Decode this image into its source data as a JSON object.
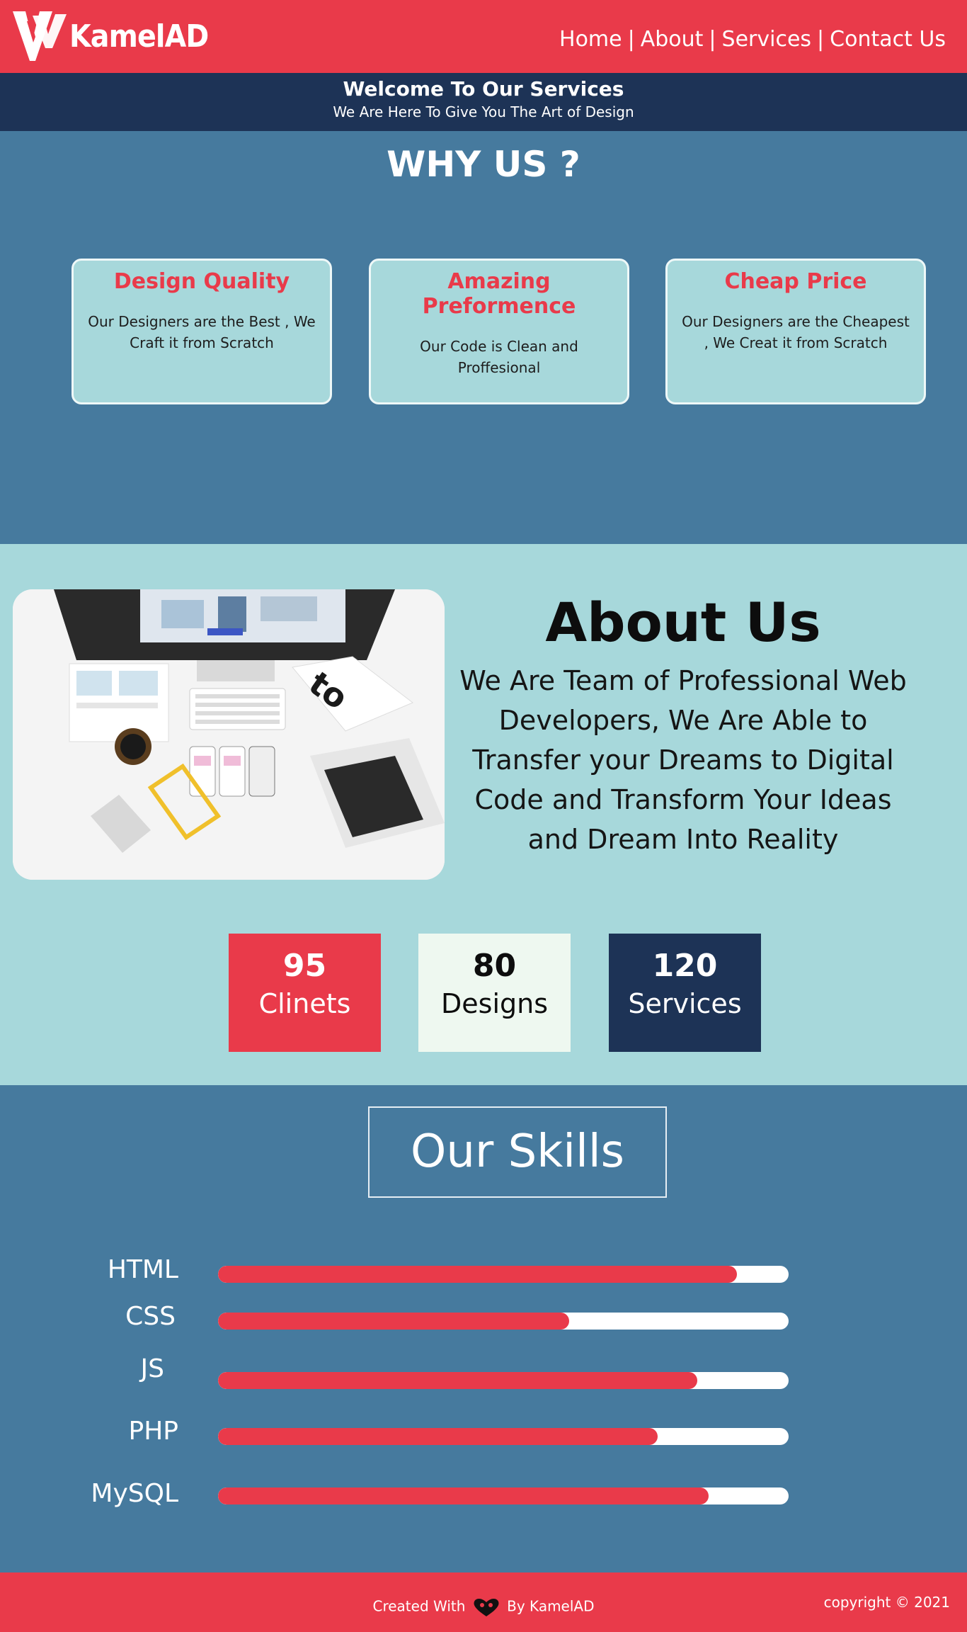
{
  "header": {
    "logo_text": "KamelAD",
    "nav": [
      "Home",
      "About",
      "Services",
      "Contact Us"
    ],
    "nav_separator": "|"
  },
  "welcome": {
    "title": "Welcome To Our Services",
    "subtitle": "We Are Here To Give You The Art of Design"
  },
  "why": {
    "title": "WHY US ?",
    "cards": [
      {
        "title": "Design Quality",
        "text": "Our Designers are the Best , We Craft it from Scratch"
      },
      {
        "title": "Amazing Preformence",
        "text": "Our Code is Clean and Proffesional"
      },
      {
        "title": "Cheap Price",
        "text": "Our Designers are the Cheapest , We Creat it from Scratch"
      }
    ]
  },
  "about": {
    "title": "About Us",
    "text": "We Are Team of Professional Web Developers, We Are Able to Transfer your Dreams to Digital Code and Transform Your Ideas and Dream Into Reality",
    "stats": [
      {
        "num": "95",
        "label": "Clinets"
      },
      {
        "num": "80",
        "label": "Designs"
      },
      {
        "num": "120",
        "label": "Services"
      }
    ]
  },
  "skills": {
    "title": "Our Skills",
    "items": [
      {
        "label": "HTML",
        "level": 0.91
      },
      {
        "label": "CSS",
        "level": 0.615
      },
      {
        "label": "JS",
        "level": 0.84
      },
      {
        "label": "PHP",
        "level": 0.77
      },
      {
        "label": "MySQL",
        "level": 0.86
      }
    ]
  },
  "footer": {
    "created_with": "Created With",
    "by": "By KamelAD",
    "copyright": "copyright © 2021"
  },
  "colors": {
    "accent": "#e93a4a",
    "navy": "#1d3356",
    "steel": "#467a9e",
    "aqua": "#a7d8db"
  }
}
